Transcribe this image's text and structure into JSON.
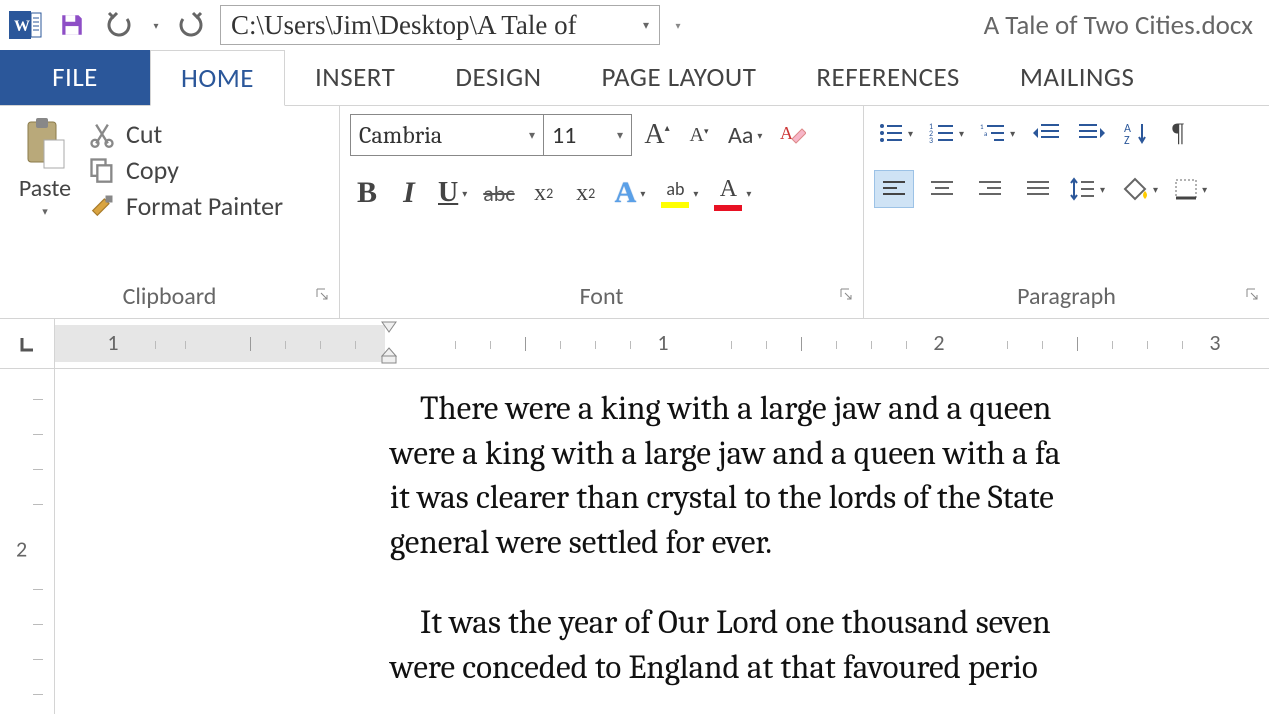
{
  "titlebar": {
    "path": "C:\\Users\\Jim\\Desktop\\A Tale of",
    "doc_title": "A Tale of Two Cities.docx"
  },
  "tabs": {
    "file": "FILE",
    "home": "HOME",
    "insert": "INSERT",
    "design": "DESIGN",
    "page_layout": "PAGE LAYOUT",
    "references": "REFERENCES",
    "mailings": "MAILINGS"
  },
  "ribbon": {
    "clipboard": {
      "label": "Clipboard",
      "paste": "Paste",
      "cut": "Cut",
      "copy": "Copy",
      "format_painter": "Format Painter"
    },
    "font": {
      "label": "Font",
      "name": "Cambria",
      "size": "11",
      "bold": "B",
      "italic": "I",
      "underline": "U",
      "strike": "abc",
      "subscript_x": "x",
      "subscript_2": "2",
      "superscript_x": "x",
      "superscript_2": "2",
      "text_effects": "A",
      "highlight_glyph": "ab",
      "font_color": "A",
      "grow": "A",
      "shrink": "A",
      "change_case": "Aa"
    },
    "paragraph": {
      "label": "Paragraph"
    }
  },
  "ruler": {
    "n1": "1",
    "n1b": "1",
    "n2": "2",
    "n3": "3",
    "v2": "2"
  },
  "document": {
    "p1_l1": "There were a king with a large jaw and a queen ",
    "p1_l2": "were a king with a large jaw and a queen with a fa",
    "p1_l3": "it was clearer than crystal to the lords of the State",
    "p1_l4": "general were settled for ever.",
    "p2_l1": "It was the year of Our Lord one thousand seven ",
    "p2_l2": "were conceded to England at that favoured perio"
  }
}
